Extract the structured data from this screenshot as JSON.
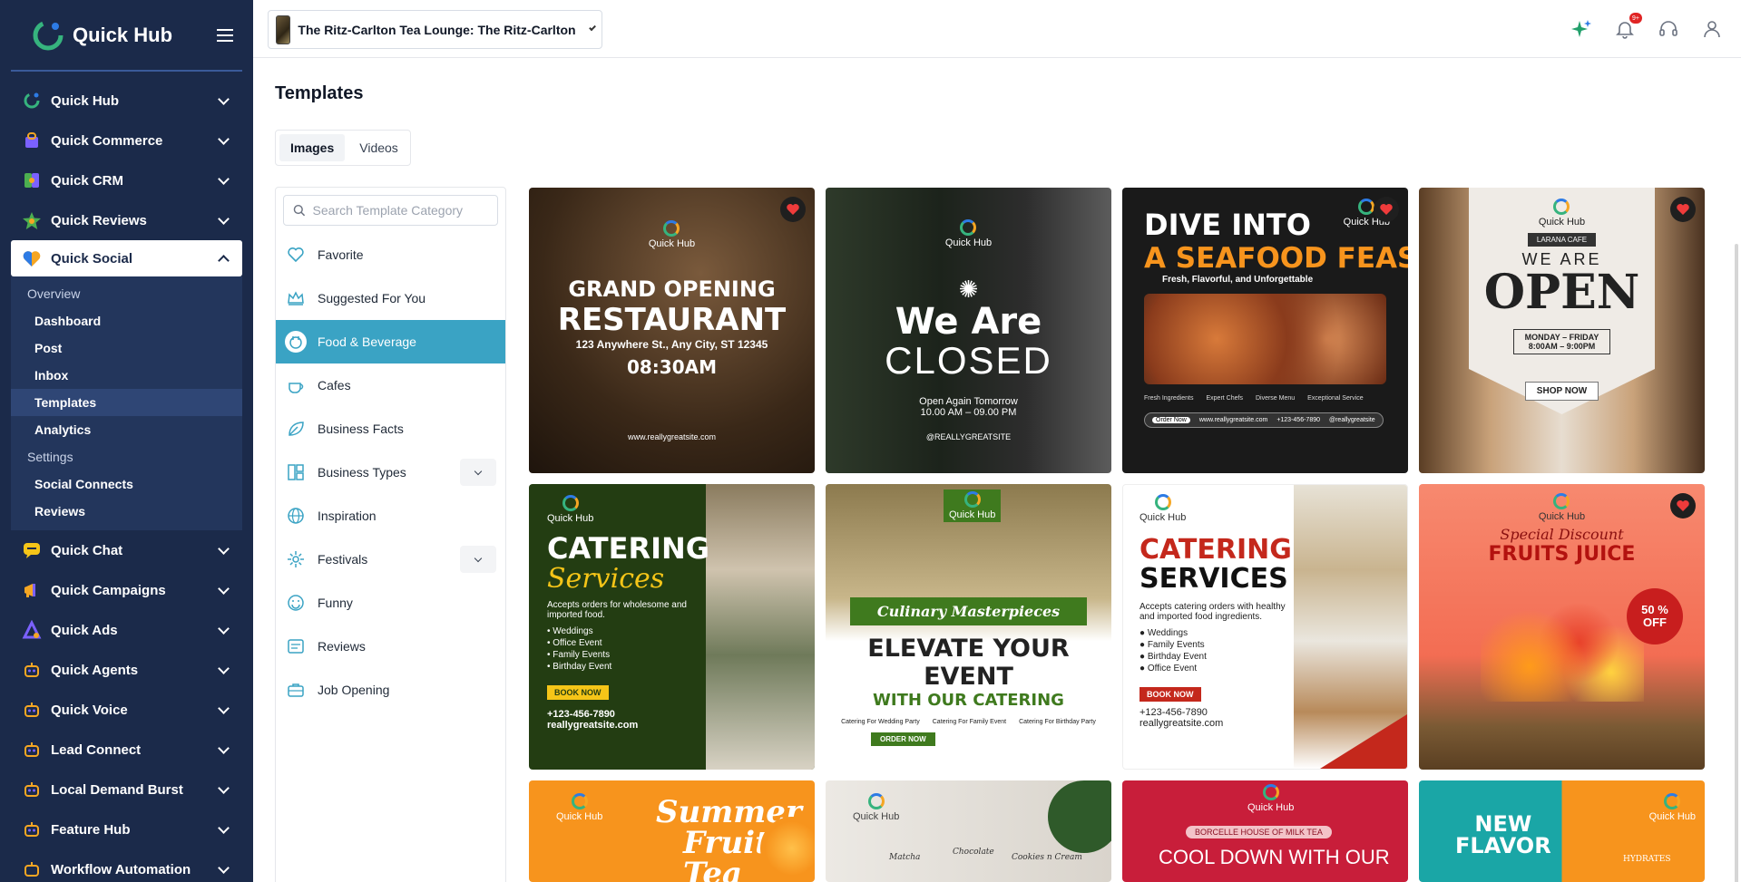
{
  "brand": {
    "name": "Quick Hub"
  },
  "sidebar": {
    "items": [
      {
        "label": "Quick Hub",
        "icon": "quick-hub-logo-icon",
        "color": "#36b37e"
      },
      {
        "label": "Quick Commerce",
        "icon": "shopping-bag-icon",
        "color": "#7b61ff"
      },
      {
        "label": "Quick CRM",
        "icon": "crm-icon",
        "color": "#4caf50"
      },
      {
        "label": "Quick Reviews",
        "icon": "star-icon",
        "color": "#4caf50"
      },
      {
        "label": "Quick Social",
        "icon": "heart-shield-icon",
        "color": "#f5a623"
      }
    ],
    "social_sub": {
      "overview": "Overview",
      "dashboard": "Dashboard",
      "post": "Post",
      "inbox": "Inbox",
      "templates": "Templates",
      "analytics": "Analytics",
      "settings": "Settings",
      "social_connects": "Social Connects",
      "reviews": "Reviews"
    },
    "items_after": [
      {
        "label": "Quick Chat",
        "icon": "chat-icon",
        "color": "#f5c518"
      },
      {
        "label": "Quick Campaigns",
        "icon": "megaphone-icon",
        "color": "#f5a623"
      },
      {
        "label": "Quick Ads",
        "icon": "ads-icon",
        "color": "#7b61ff"
      },
      {
        "label": "Quick Agents",
        "icon": "robot-icon",
        "color": "#f5a623"
      },
      {
        "label": "Quick Voice",
        "icon": "voice-robot-icon",
        "color": "#f5a623"
      },
      {
        "label": "Lead Connect",
        "icon": "lead-icon",
        "color": "#f5a623"
      },
      {
        "label": "Local Demand Burst",
        "icon": "burst-icon",
        "color": "#f5a623"
      },
      {
        "label": "Feature Hub",
        "icon": "feature-icon",
        "color": "#f5a623"
      },
      {
        "label": "Workflow Automation",
        "icon": "workflow-icon",
        "color": "#f5a623"
      }
    ]
  },
  "topbar": {
    "location": "The Ritz-Carlton Tea Lounge: The Ritz-Carlton",
    "notifications_badge": "9+"
  },
  "page": {
    "title": "Templates",
    "tabs": [
      "Images",
      "Videos"
    ]
  },
  "categories": {
    "search_placeholder": "Search Template Category",
    "items": [
      "Favorite",
      "Suggested For You",
      "Food & Beverage",
      "Cafes",
      "Business Facts",
      "Business Types",
      "Inspiration",
      "Festivals",
      "Funny",
      "Reviews",
      "Job Opening"
    ]
  },
  "cards": {
    "c1": {
      "brand": "Quick Hub",
      "line1": "GRAND OPENING",
      "line2": "RESTAURANT",
      "line3": "123 Anywhere St., Any City, ST 12345",
      "line4": "08:30AM",
      "site": "www.reallygreatsite.com"
    },
    "c2": {
      "brand": "Quick Hub",
      "line1": "We Are",
      "line2": "CLOSED",
      "line3": "Open Again Tomorrow",
      "line4": "10.00 AM – 09.00 PM",
      "handle": "@REALLYGREATSITE"
    },
    "c3": {
      "brand": "Quick Hub",
      "line1": "DIVE INTO",
      "line2": "A SEAFOOD FEAST",
      "line3": "Fresh, Flavorful, and Unforgettable",
      "f1": "Fresh Ingredients",
      "f2": "Expert Chefs",
      "f3": "Diverse Menu",
      "f4": "Exceptional Service",
      "order": "Order Now",
      "site": "www.reallygreatsite.com",
      "phone": "+123-456-7890",
      "social": "@reallygreatsite"
    },
    "c4": {
      "brand": "Quick Hub",
      "cafe": "LARANA CAFE",
      "line1": "WE ARE",
      "line2": "OPEN",
      "line3": "MONDAY – FRIDAY",
      "line4": "8:00AM – 9:00PM",
      "cta": "SHOP NOW"
    },
    "c5": {
      "brand": "Quick Hub",
      "line1": "CATERING",
      "line2": "Services",
      "desc": "Accepts orders for wholesome and imported food.",
      "b1": "Weddings",
      "b2": "Office Event",
      "b3": "Family Events",
      "b4": "Birthday Event",
      "cta": "BOOK NOW",
      "phone": "+123-456-7890",
      "site": "reallygreatsite.com"
    },
    "c6": {
      "brand": "Quick Hub",
      "line1": "Culinary Masterpieces",
      "line2": "ELEVATE YOUR EVENT",
      "line3": "WITH OUR CATERING",
      "b1": "Catering For Wedding Party",
      "b2": "Catering For Family Event",
      "b3": "Catering For Birthday Party",
      "cta": "ORDER NOW"
    },
    "c7": {
      "brand": "Quick Hub",
      "line1": "CATERING",
      "line2": "SERVICES",
      "desc": "Accepts catering orders with healthy and imported food ingredients.",
      "b1": "Weddings",
      "b2": "Family Events",
      "b3": "Birthday Event",
      "b4": "Office Event",
      "cta": "BOOK NOW",
      "phone": "+123-456-7890",
      "site": "reallygreatsite.com"
    },
    "c8": {
      "brand": "Quick Hub",
      "line1": "Special Discount",
      "line2": "FRUITS JUICE",
      "badge": "50 % OFF"
    },
    "c9": {
      "brand": "Quick Hub",
      "line1": "Summer",
      "line2": "Fruit Tea"
    },
    "c10": {
      "brand": "Quick Hub",
      "l1": "Matcha",
      "l2": "Chocolate",
      "l3": "Cookies n Cream"
    },
    "c11": {
      "brand": "Quick Hub",
      "line1": "BORCELLE HOUSE OF MILK TEA",
      "line2": "COOL DOWN WITH OUR"
    },
    "c12": {
      "brand": "Quick Hub",
      "line1": "NEW",
      "line2": "FLAVOR",
      "line3": "HYDRATES"
    }
  }
}
